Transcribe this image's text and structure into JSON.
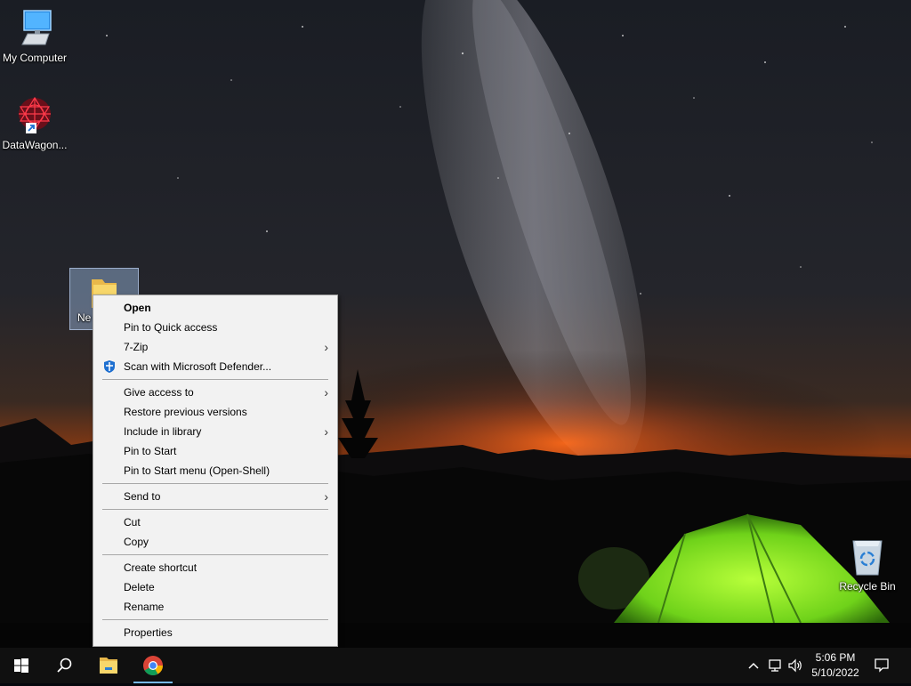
{
  "desktop": {
    "icons": {
      "my_computer": "My Computer",
      "datawagon": "DataWagon...",
      "new_folder": "Ne",
      "recycle_bin": "Recycle Bin"
    }
  },
  "context_menu": {
    "items": {
      "open": "Open",
      "pin_quick_access": "Pin to Quick access",
      "seven_zip": "7-Zip",
      "scan_defender": "Scan with Microsoft Defender...",
      "give_access": "Give access to",
      "restore_versions": "Restore previous versions",
      "include_library": "Include in library",
      "pin_start": "Pin to Start",
      "pin_start_menu": "Pin to Start menu (Open-Shell)",
      "send_to": "Send to",
      "cut": "Cut",
      "copy": "Copy",
      "create_shortcut": "Create shortcut",
      "delete": "Delete",
      "rename": "Rename",
      "properties": "Properties"
    },
    "submenu_arrow": "›"
  },
  "taskbar": {
    "time": "5:06 PM",
    "date": "5/10/2022",
    "pinned": [
      "start-icon",
      "search-icon",
      "file-explorer-icon",
      "chrome-icon"
    ],
    "tray": [
      "chevron-up-icon",
      "network-icon",
      "volume-icon",
      "notification-icon"
    ]
  },
  "colors": {
    "accent": "#76b9ed",
    "menu_bg": "#f2f2f2",
    "taskbar_bg": "#101010"
  }
}
